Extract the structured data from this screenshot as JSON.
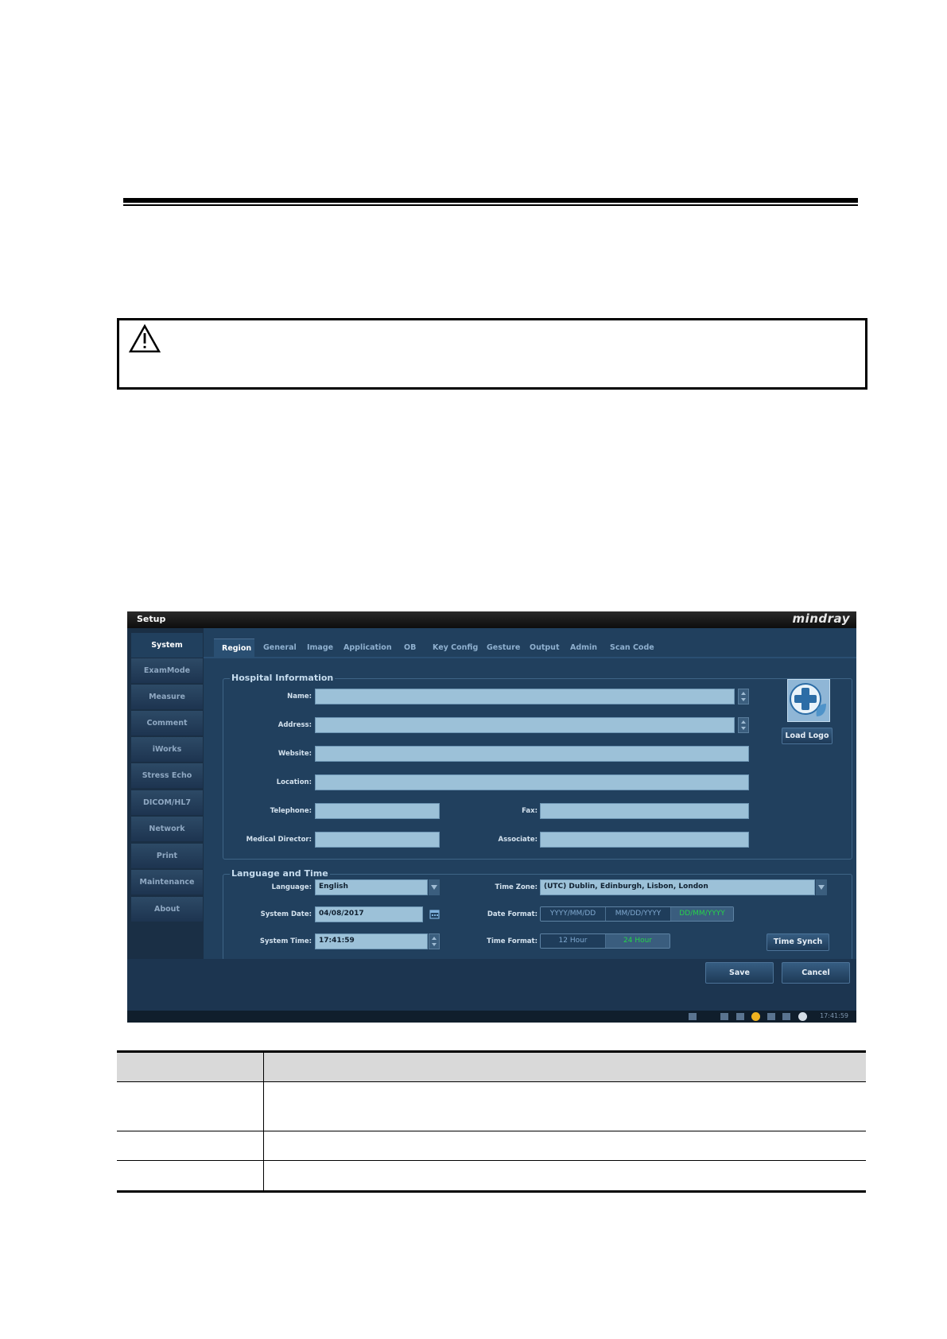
{
  "window": {
    "title": "Setup",
    "brand": "mindray"
  },
  "sidebar": {
    "items": [
      {
        "label": "System"
      },
      {
        "label": "ExamMode"
      },
      {
        "label": "Measure"
      },
      {
        "label": "Comment"
      },
      {
        "label": "iWorks"
      },
      {
        "label": "Stress Echo"
      },
      {
        "label": "DICOM/HL7"
      },
      {
        "label": "Network"
      },
      {
        "label": "Print"
      },
      {
        "label": "Maintenance"
      },
      {
        "label": "About"
      }
    ],
    "active": "System"
  },
  "tabs": {
    "items": [
      {
        "label": "Region"
      },
      {
        "label": "General"
      },
      {
        "label": "Image"
      },
      {
        "label": "Application"
      },
      {
        "label": "OB"
      },
      {
        "label": "Key Config"
      },
      {
        "label": "Gesture"
      },
      {
        "label": "Output"
      },
      {
        "label": "Admin"
      },
      {
        "label": "Scan Code"
      }
    ],
    "active": "Region"
  },
  "hospital": {
    "title": "Hospital Information",
    "name_label": "Name:",
    "address_label": "Address:",
    "website_label": "Website:",
    "location_label": "Location:",
    "telephone_label": "Telephone:",
    "fax_label": "Fax:",
    "director_label": "Medical Director:",
    "associate_label": "Associate:",
    "name_value": "",
    "address_value": "",
    "website_value": "",
    "location_value": "",
    "telephone_value": "",
    "fax_value": "",
    "director_value": "",
    "associate_value": "",
    "load_logo_label": "Load Logo"
  },
  "lang_time": {
    "title": "Language and Time",
    "language_label": "Language:",
    "language_value": "English",
    "timezone_label": "Time Zone:",
    "timezone_value": "(UTC) Dublin, Edinburgh, Lisbon, London",
    "date_label": "System Date:",
    "date_value": "04/08/2017",
    "date_format_label": "Date Format:",
    "date_formats": [
      "YYYY/MM/DD",
      "MM/DD/YYYY",
      "DD/MM/YYYY"
    ],
    "date_format_selected": "DD/MM/YYYY",
    "time_label": "System Time:",
    "time_value": "17:41:59",
    "time_format_label": "Time Format:",
    "time_formats": [
      "12 Hour",
      "24 Hour"
    ],
    "time_format_selected": "24 Hour",
    "time_synch_label": "Time Synch"
  },
  "footer": {
    "save_label": "Save",
    "cancel_label": "Cancel",
    "status_time": "17:41:59"
  },
  "colors": {
    "panel": "#21405e",
    "field": "#9cc1d8",
    "selected_text": "#26d24a"
  }
}
